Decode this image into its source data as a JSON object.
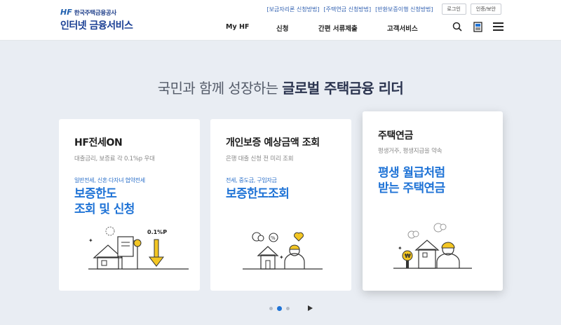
{
  "header": {
    "logo_mark": "HF",
    "logo_org": "한국주택금융공사",
    "logo_service": "인터넷 금융서비스",
    "util_links": [
      "[보금자리론 신청방법]",
      "[주택연금 신청방법]",
      "[반환보증이행 신청방법]"
    ],
    "login_label": "로그인",
    "auth_label": "인증/보안",
    "nav": [
      "My HF",
      "신청",
      "간편 서류제출",
      "고객서비스"
    ]
  },
  "hero": {
    "headline_normal": "국민과 함께 성장하는 ",
    "headline_bold": "글로벌 주택금융 리더"
  },
  "cards": [
    {
      "title": "HF전세ON",
      "desc": "대출금리, 보증료 각 0.1%p 우대",
      "tag": "일반전세, 신혼·다자녀 협약전세",
      "big_line1": "보증한도",
      "big_line2": "조회 및 신청",
      "illus_label": "0.1%P"
    },
    {
      "title": "개인보증 예상금액 조회",
      "desc": "은행 대출 신청 전 미리 조회",
      "tag": "전세, 중도금, 구입자금",
      "big_line1": "보증한도조회"
    },
    {
      "title": "주택연금",
      "desc": "평생거주, 평생지급을 약속",
      "big_line1": "평생 월급처럼",
      "big_line2": "받는 주택연금",
      "illus_label": "₩"
    }
  ],
  "pager": {
    "total": 3,
    "active": 2
  },
  "colors": {
    "brand": "#1a3f94",
    "accent": "#1f73d6",
    "link": "#2f5fb0",
    "coin": "#f3c623"
  }
}
